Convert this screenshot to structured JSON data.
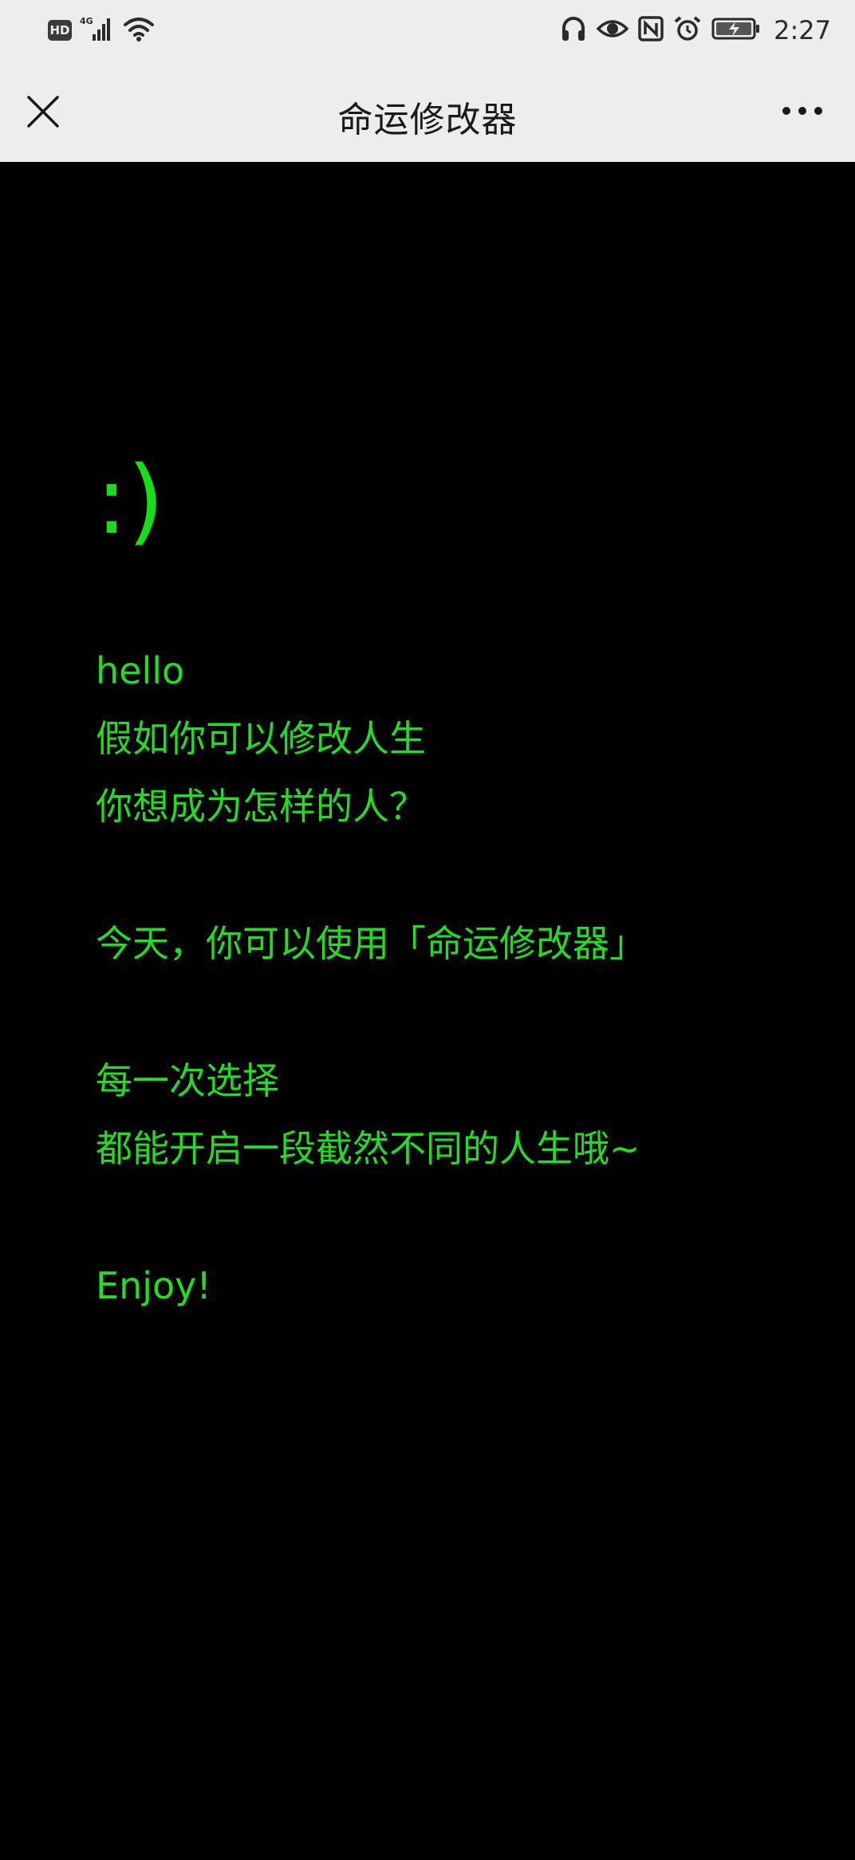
{
  "status_bar": {
    "hd_label": "HD",
    "network_label": "4G",
    "time": "2:27"
  },
  "nav": {
    "title": "命运修改器"
  },
  "content": {
    "smiley": ":)",
    "lines": [
      "hello",
      "假如你可以修改人生",
      "你想成为怎样的人？",
      "今天，你可以使用「命运修改器」",
      "每一次选择",
      "都能开启一段截然不同的人生哦~",
      "Enjoy!"
    ]
  },
  "colors": {
    "background": "#000000",
    "text_green": "#1fe01f",
    "bar_background": "#ededed"
  },
  "icons": {
    "close": "close-icon",
    "more": "more-dots-icon",
    "headphones": "headphones-icon",
    "eye": "eye-icon",
    "nfc": "nfc-icon",
    "alarm": "alarm-icon",
    "battery": "battery-charging-icon",
    "signal": "signal-icon",
    "wifi": "wifi-icon"
  }
}
